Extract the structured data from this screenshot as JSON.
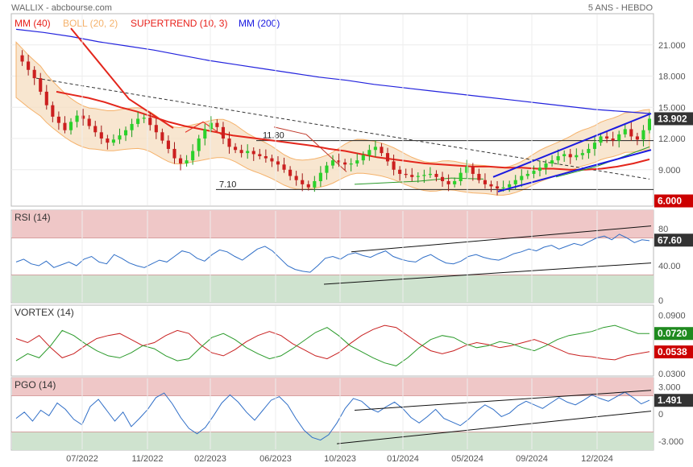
{
  "header": {
    "left": "WALLIX - abcbourse.com",
    "right": "5 ANS - HEBDO"
  },
  "legend": [
    {
      "label": "MM (40)",
      "color": "#e8201a"
    },
    {
      "label": "BOLL (20, 2)",
      "color": "#f5b26b"
    },
    {
      "label": "SUPERTREND (10, 3)",
      "color": "#e8201a"
    },
    {
      "label": "MM (200)",
      "color": "#1a1ae0"
    }
  ],
  "x_labels": [
    "07/2022",
    "11/2022",
    "02/2023",
    "06/2023",
    "10/2023",
    "01/2024",
    "05/2024",
    "09/2024",
    "12/2024"
  ],
  "colors": {
    "up": "#2bd12b",
    "down": "#cc1f1f",
    "price_axis_badge": "#333333",
    "low_badge": "#cc0000",
    "rsi_line": "#2f6ec7",
    "vortex_plus": "#2a9a2a",
    "vortex_minus": "#c82020",
    "overbought_band": "#efc7c7",
    "oversold_band": "#cfe3cf"
  },
  "chart_data": [
    {
      "type": "candlestick",
      "title": "",
      "y_ticks": [
        "21.000",
        "18.000",
        "15.000",
        "12.000",
        "9.000"
      ],
      "ylim": [
        5.5,
        24.0
      ],
      "current_value": "13.902",
      "low_marker": "6.000",
      "annotations": [
        {
          "label": "11.80",
          "value": 11.8
        },
        {
          "label": "7.10",
          "value": 7.1
        }
      ],
      "series": [
        {
          "name": "",
          "kind": "ohlc_close_trace",
          "values": [
            20.0,
            19.4,
            18.6,
            17.8,
            16.5,
            15.2,
            14.1,
            13.5,
            12.8,
            13.6,
            14.2,
            13.9,
            13.2,
            12.6,
            12.0,
            11.6,
            11.9,
            12.3,
            12.8,
            13.4,
            13.9,
            14.0,
            13.3,
            12.6,
            11.8,
            11.0,
            10.1,
            9.6,
            9.9,
            10.8,
            12.0,
            12.9,
            13.5,
            13.1,
            12.0,
            11.2,
            10.9,
            10.6,
            10.8,
            10.5,
            10.3,
            10.1,
            9.8,
            9.5,
            9.0,
            8.4,
            8.0,
            7.6,
            7.3,
            7.9,
            8.7,
            9.4,
            9.9,
            9.7,
            9.5,
            9.6,
            9.9,
            10.4,
            10.9,
            11.2,
            10.6,
            9.8,
            9.0,
            8.6,
            8.5,
            8.3,
            8.4,
            8.5,
            8.6,
            8.3,
            7.9,
            7.6,
            7.9,
            8.7,
            9.3,
            8.6,
            8.0,
            7.6,
            7.4,
            7.2,
            7.3,
            7.6,
            8.0,
            8.4,
            8.6,
            8.9,
            9.2,
            9.6,
            9.9,
            10.3,
            10.5,
            10.2,
            10.4,
            10.6,
            11.0,
            11.6,
            12.2,
            12.0,
            11.8,
            12.4,
            12.9,
            12.2,
            11.9,
            12.8,
            13.9
          ]
        },
        {
          "name": "MM (40)",
          "values": [
            16.5,
            16.2,
            15.9,
            15.5,
            15.0,
            14.6,
            14.1,
            13.6,
            13.2,
            12.9,
            12.6,
            12.3,
            12.1,
            11.9,
            11.7,
            11.5,
            11.3,
            11.0,
            10.8,
            10.5,
            10.2,
            10.0,
            9.8,
            9.6,
            9.5,
            9.4,
            9.3,
            9.3,
            9.2,
            9.2,
            9.1,
            9.1,
            9.0,
            9.0,
            9.1,
            9.3,
            9.6,
            10.0
          ]
        },
        {
          "name": "MM (200)",
          "values": [
            22.5,
            22.2,
            21.8,
            21.3,
            20.9,
            20.5,
            20.0,
            19.5,
            19.1,
            18.7,
            18.3,
            17.9,
            17.6,
            17.2,
            16.9,
            16.6,
            16.3,
            16.0,
            15.7,
            15.4,
            15.1,
            14.8,
            14.6,
            14.4
          ]
        }
      ]
    },
    {
      "type": "line",
      "title": "RSI (14)",
      "y_ticks": [
        "80",
        "67.60",
        "40.00",
        "0"
      ],
      "ylim": [
        0,
        100
      ],
      "current_value": "67.60",
      "bands": [
        [
          70,
          100
        ],
        [
          0,
          30
        ]
      ],
      "series": [
        {
          "name": "RSI",
          "values": [
            44,
            47,
            42,
            40,
            45,
            38,
            41,
            44,
            40,
            47,
            50,
            44,
            42,
            52,
            48,
            43,
            40,
            38,
            42,
            46,
            44,
            50,
            56,
            54,
            48,
            45,
            52,
            57,
            55,
            50,
            46,
            52,
            58,
            61,
            56,
            48,
            40,
            36,
            34,
            33,
            40,
            48,
            50,
            47,
            52,
            54,
            51,
            49,
            53,
            56,
            50,
            47,
            45,
            44,
            49,
            52,
            47,
            43,
            42,
            45,
            50,
            52,
            49,
            47,
            46,
            49,
            53,
            55,
            58,
            56,
            60,
            62,
            58,
            61,
            64,
            62,
            66,
            70,
            72,
            68,
            74,
            70,
            65,
            68,
            67
          ]
        }
      ]
    },
    {
      "type": "line",
      "title": "VORTEX (14)",
      "y_ticks": [
        "0.0900",
        "0.0720",
        "0.0538",
        "0.0300"
      ],
      "ylim": [
        0.03,
        0.1
      ],
      "series": [
        {
          "name": "VI+",
          "values": [
            0.045,
            0.052,
            0.048,
            0.06,
            0.075,
            0.07,
            0.062,
            0.055,
            0.05,
            0.048,
            0.053,
            0.06,
            0.057,
            0.05,
            0.045,
            0.047,
            0.058,
            0.068,
            0.072,
            0.066,
            0.058,
            0.052,
            0.047,
            0.05,
            0.057,
            0.065,
            0.073,
            0.078,
            0.07,
            0.06,
            0.054,
            0.048,
            0.043,
            0.04,
            0.048,
            0.058,
            0.066,
            0.07,
            0.068,
            0.062,
            0.058,
            0.06,
            0.064,
            0.062,
            0.058,
            0.055,
            0.06,
            0.066,
            0.07,
            0.072,
            0.074,
            0.078,
            0.08,
            0.076,
            0.072,
            0.072
          ]
        },
        {
          "name": "VI-",
          "values": [
            0.067,
            0.063,
            0.07,
            0.058,
            0.048,
            0.052,
            0.06,
            0.067,
            0.07,
            0.072,
            0.066,
            0.06,
            0.063,
            0.07,
            0.075,
            0.072,
            0.061,
            0.053,
            0.05,
            0.056,
            0.064,
            0.07,
            0.074,
            0.07,
            0.062,
            0.056,
            0.05,
            0.047,
            0.053,
            0.062,
            0.07,
            0.076,
            0.08,
            0.078,
            0.07,
            0.062,
            0.055,
            0.052,
            0.055,
            0.06,
            0.063,
            0.061,
            0.058,
            0.06,
            0.063,
            0.066,
            0.062,
            0.057,
            0.052,
            0.05,
            0.049,
            0.047,
            0.046,
            0.05,
            0.052,
            0.054
          ]
        }
      ]
    },
    {
      "type": "line",
      "title": "PGO (14)",
      "y_ticks": [
        "3.000",
        "1.491",
        "0",
        "-3.000"
      ],
      "ylim": [
        -4,
        4
      ],
      "current_value": "1.491",
      "bands": [
        [
          2,
          4
        ],
        [
          -4,
          -2
        ]
      ],
      "series": [
        {
          "name": "PGO",
          "values": [
            -0.5,
            0.2,
            -0.8,
            0.4,
            -0.2,
            1.2,
            0.5,
            -0.6,
            -1.2,
            0.8,
            1.6,
            0.4,
            -0.8,
            0.2,
            -1.4,
            -0.5,
            0.5,
            1.8,
            2.3,
            1.1,
            -0.4,
            -1.6,
            -2.2,
            -1.5,
            -0.2,
            1.2,
            2.1,
            1.3,
            0.2,
            -0.7,
            0.4,
            1.5,
            1.9,
            1.0,
            -0.5,
            -1.8,
            -2.6,
            -2.9,
            -2.3,
            -1.0,
            0.6,
            1.7,
            1.4,
            0.6,
            0.2,
            0.8,
            1.3,
            0.6,
            -0.4,
            -1.0,
            -0.3,
            0.5,
            -0.5,
            -0.9,
            -1.3,
            -0.6,
            0.3,
            1.0,
            0.5,
            -0.3,
            0.1,
            0.9,
            1.4,
            1.0,
            0.6,
            1.2,
            1.8,
            1.3,
            1.0,
            1.5,
            2.1,
            1.7,
            1.4,
            1.9,
            2.4,
            1.8,
            1.1,
            1.5
          ]
        }
      ]
    }
  ]
}
